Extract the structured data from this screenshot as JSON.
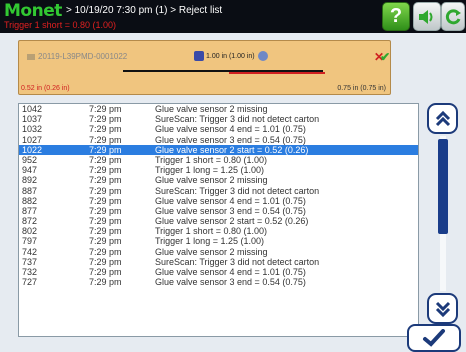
{
  "header": {
    "brand": "Monet",
    "crumb": "> 10/19/20  7:30 pm  (1) > Reject list",
    "alert": "Trigger 1 short = 0.80 (1.00)",
    "help_icon": "help-icon",
    "sound_icon": "speaker-icon",
    "refresh_icon": "refresh-icon"
  },
  "panel": {
    "product_id": "20119-L39PMD-0001022",
    "measure": "1.00 in (1.00 in)",
    "left_value": "0.52 in (0.26 in)",
    "right_value": "0.75 in (0.75 in)"
  },
  "rejects": [
    {
      "id": "1042",
      "time": "7:29 pm",
      "message": "Glue valve sensor 2 missing"
    },
    {
      "id": "1037",
      "time": "7:29 pm",
      "message": "SureScan: Trigger 3 did not detect carton"
    },
    {
      "id": "1032",
      "time": "7:29 pm",
      "message": "Glue valve sensor 4 end = 1.01 (0.75)"
    },
    {
      "id": "1027",
      "time": "7:29 pm",
      "message": "Glue valve sensor 3 end = 0.54 (0.75)"
    },
    {
      "id": "1022",
      "time": "7:29 pm",
      "message": "Glue valve sensor 2 start = 0.52 (0.26)",
      "selected": true
    },
    {
      "id": "952",
      "time": "7:29 pm",
      "message": "Trigger 1 short = 0.80 (1.00)"
    },
    {
      "id": "947",
      "time": "7:29 pm",
      "message": "Trigger 1 long = 1.25 (1.00)"
    },
    {
      "id": "892",
      "time": "7:29 pm",
      "message": "Glue valve sensor 2 missing"
    },
    {
      "id": "887",
      "time": "7:29 pm",
      "message": "SureScan: Trigger 3 did not detect carton"
    },
    {
      "id": "882",
      "time": "7:29 pm",
      "message": "Glue valve sensor 4 end = 1.01 (0.75)"
    },
    {
      "id": "877",
      "time": "7:29 pm",
      "message": "Glue valve sensor 3 end = 0.54 (0.75)"
    },
    {
      "id": "872",
      "time": "7:29 pm",
      "message": "Glue valve sensor 2 start = 0.52 (0.26)"
    },
    {
      "id": "802",
      "time": "7:29 pm",
      "message": "Trigger 1 short = 0.80 (1.00)"
    },
    {
      "id": "797",
      "time": "7:29 pm",
      "message": "Trigger 1 long = 1.25 (1.00)"
    },
    {
      "id": "742",
      "time": "7:29 pm",
      "message": "Glue valve sensor 2 missing"
    },
    {
      "id": "737",
      "time": "7:29 pm",
      "message": "SureScan: Trigger 3 did not detect carton"
    },
    {
      "id": "732",
      "time": "7:29 pm",
      "message": "Glue valve sensor 4 end = 1.01 (0.75)"
    },
    {
      "id": "727",
      "time": "7:29 pm",
      "message": "Glue valve sensor 3 end = 0.54 (0.75)"
    }
  ],
  "colors": {
    "topbar": "#0a0d14",
    "brand": "#32c832",
    "alert": "#e02020",
    "panel": "#f0c57f",
    "selection": "#2b7de0",
    "scroll_accent": "#1c3a7a"
  }
}
